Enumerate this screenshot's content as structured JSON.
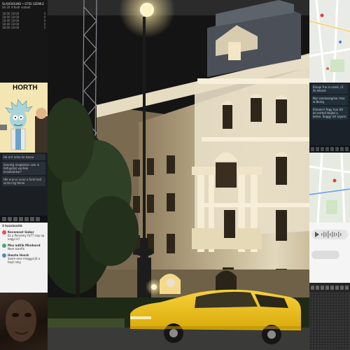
{
  "collage": {
    "schedule": {
      "title": "SLAVESOUND • GTSS SZEMLE",
      "subtitle": "04 20 4 Kultr sobakt",
      "rows": [
        {
          "time": "18:00 18:00",
          "value": "3"
        },
        {
          "time": "18:00 18:00",
          "value": "4"
        },
        {
          "time": "18:00 18:00",
          "value": "4"
        },
        {
          "time": "18:00 18:00",
          "value": "4"
        },
        {
          "time": "18:00 18:00",
          "value": "5"
        }
      ]
    },
    "meme": {
      "caption": "HORTH"
    },
    "chat_left": {
      "messages": [
        "Ha ent neha ko kazsa",
        "Szeretg megbiztos szer is felfujahat vanfele breaktakkor?",
        "Hkl erarce vone a fonti ked sirzini hg folnei"
      ]
    },
    "feed": {
      "header": "3 hozzászóló",
      "items": [
        {
          "name": "Kevemnat Gabor",
          "text": "Ez a Porsemy FaTT nap op vagyi is?"
        },
        {
          "name": "Mez mAtik Mindnord",
          "text": "Nem ezerfin"
        },
        {
          "name": "Haszte Hoszk",
          "text": "Szere elve meggyirjit a heyt reky."
        }
      ]
    },
    "chat_right": {
      "messages": [
        "Elnapi friv in szerk, r2 itt lelszet",
        "Nar szerkeseg/sar mos w Bonlg",
        "Elnamcri fegy tsar blt lel mirteli ttejtel a keten. Soggy ish szyorn"
      ]
    }
  },
  "photo": {
    "subject": "night city scene",
    "colors": {
      "sky": "#141414",
      "facade": "#d8cdb0",
      "facade_shadow": "#8c7a5c",
      "taxi": "#f2c20f",
      "lamp_glow": "#fff6d0"
    }
  }
}
